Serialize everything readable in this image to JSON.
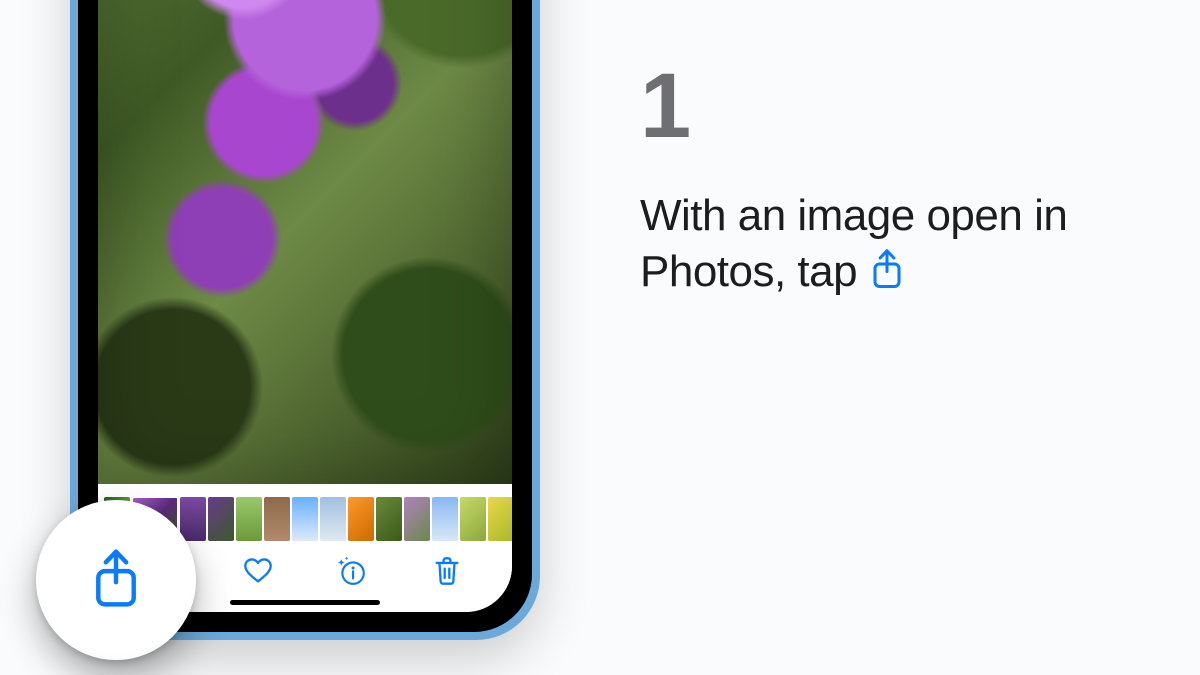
{
  "step": {
    "number": "1",
    "text_before_icon": "With an image open in Photos, tap ",
    "icon_name": "share-icon"
  },
  "toolbar": {
    "share": "share-icon",
    "favorite": "heart-icon",
    "info": "info-sparkle-icon",
    "delete": "trash-icon"
  },
  "thumbnails": [
    {
      "bg": "linear-gradient(135deg,#2a5a1a,#6aa83a,#c55aa0)"
    },
    {
      "bg": "linear-gradient(135deg,#b060d0,#5a2a7a,#3a5a20)",
      "selected": true
    },
    {
      "bg": "linear-gradient(180deg,#7a4aa0,#4a2a6a)"
    },
    {
      "bg": "linear-gradient(135deg,#6a3a8a,#3a5a2a)"
    },
    {
      "bg": "linear-gradient(180deg,#9ac86a,#6a9a3a)"
    },
    {
      "bg": "linear-gradient(180deg,#8d6a4a,#b08a6a)"
    },
    {
      "bg": "linear-gradient(180deg,#6ab0ff,#dceaf8)"
    },
    {
      "bg": "linear-gradient(180deg,#a0c0e0,#e0e8f0)"
    },
    {
      "bg": "linear-gradient(135deg,#ff9a2a,#cc6a00)"
    },
    {
      "bg": "linear-gradient(135deg,#6a8a3a,#3a5a1a)"
    },
    {
      "bg": "linear-gradient(135deg,#b080c0,#6a8a4a)"
    },
    {
      "bg": "linear-gradient(180deg,#88b8f0,#d8e8f8)"
    },
    {
      "bg": "linear-gradient(135deg,#c8d86a,#8aa83a)"
    },
    {
      "bg": "linear-gradient(135deg,#e8d84a,#a8b82a)"
    }
  ],
  "colors": {
    "ios_blue": "#0a7aff",
    "gray_text": "#6e6e73"
  }
}
